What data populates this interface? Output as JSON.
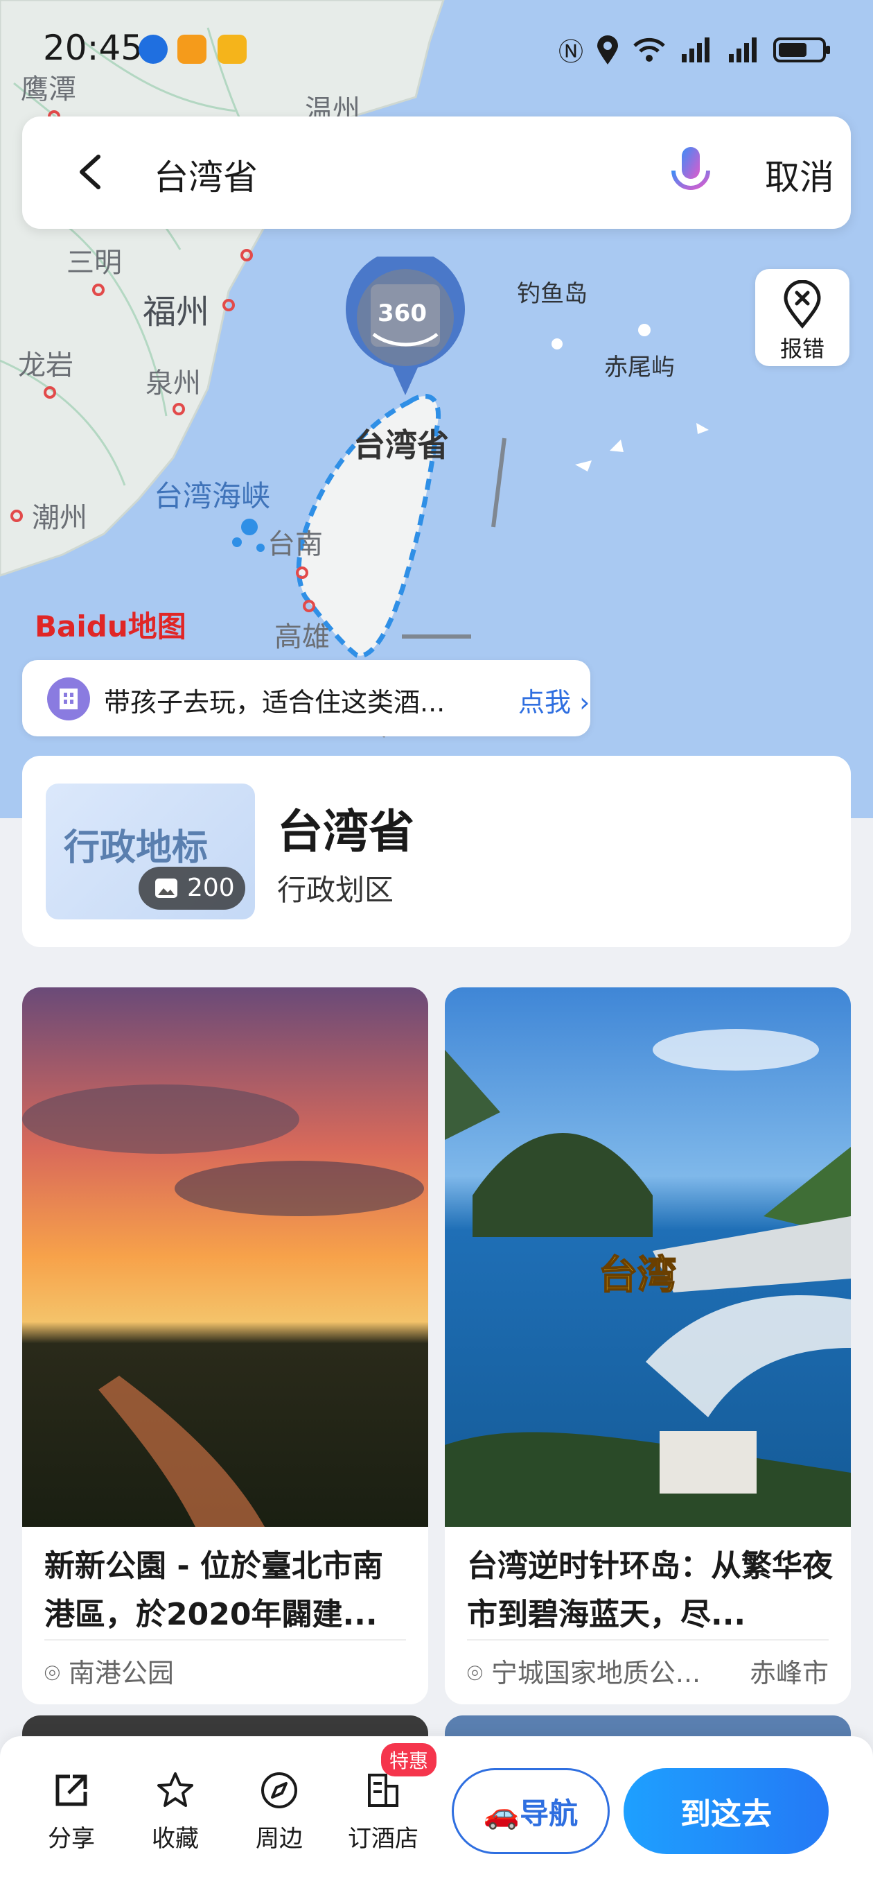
{
  "status_bar": {
    "time": "20:45"
  },
  "search": {
    "query": "台湾省",
    "cancel_label": "取消"
  },
  "map": {
    "labels": {
      "yingtan": "鹰潭",
      "wenzhou": "温州",
      "sanming": "三明",
      "fuzhou": "福州",
      "longyan": "龙岩",
      "quanzhou": "泉州",
      "chaozhou": "潮州",
      "strait": "台湾海峡",
      "tainan": "台南",
      "kaohsiung": "高雄",
      "taiwan": "台湾省",
      "diaoyu": "钓鱼岛",
      "chiwei": "赤尾屿",
      "pano": "360"
    },
    "report_label": "报错",
    "logo_text": "Baidu地图"
  },
  "promo": {
    "text": "带孩子去玩，适合住这类酒...",
    "link": "点我"
  },
  "place": {
    "thumb_title": "行政地标",
    "photo_count": "200",
    "name": "台湾省",
    "type": "行政划区"
  },
  "feed": [
    {
      "title": "新新公園 - 位於臺北市南港區，於2020年闢建...",
      "location": "南港公园",
      "city": ""
    },
    {
      "title": "台湾逆时针环岛：从繁华夜市到碧海蓝天，尽...",
      "location": "宁城国家地质公...",
      "city": "赤峰市",
      "overlay": "台湾"
    }
  ],
  "bottom_bar": {
    "share": "分享",
    "favorite": "收藏",
    "nearby": "周边",
    "hotel": "订酒店",
    "hotel_badge": "特惠",
    "navigate": "导航",
    "go_there": "到这去"
  }
}
